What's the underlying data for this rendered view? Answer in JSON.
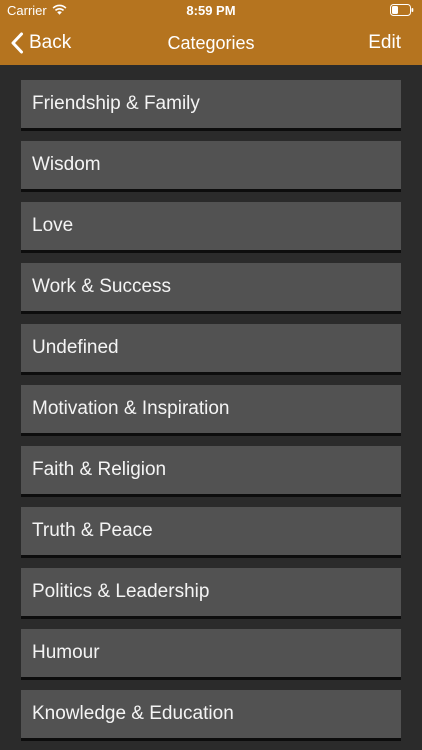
{
  "status_bar": {
    "carrier": "Carrier",
    "time": "8:59 PM",
    "wifi_icon": "wifi-icon",
    "battery_icon": "battery-icon"
  },
  "nav_bar": {
    "back_label": "Back",
    "title": "Categories",
    "edit_label": "Edit",
    "background_color": "#b5741f"
  },
  "categories": [
    {
      "label": "Friendship & Family"
    },
    {
      "label": "Wisdom"
    },
    {
      "label": "Love"
    },
    {
      "label": "Work & Success"
    },
    {
      "label": "Undefined"
    },
    {
      "label": "Motivation & Inspiration"
    },
    {
      "label": "Faith & Religion"
    },
    {
      "label": "Truth & Peace"
    },
    {
      "label": "Politics & Leadership"
    },
    {
      "label": "Humour"
    },
    {
      "label": "Knowledge & Education"
    }
  ],
  "colors": {
    "background": "#2b2b2b",
    "row": "#525252",
    "text": "#f4f4f4"
  }
}
